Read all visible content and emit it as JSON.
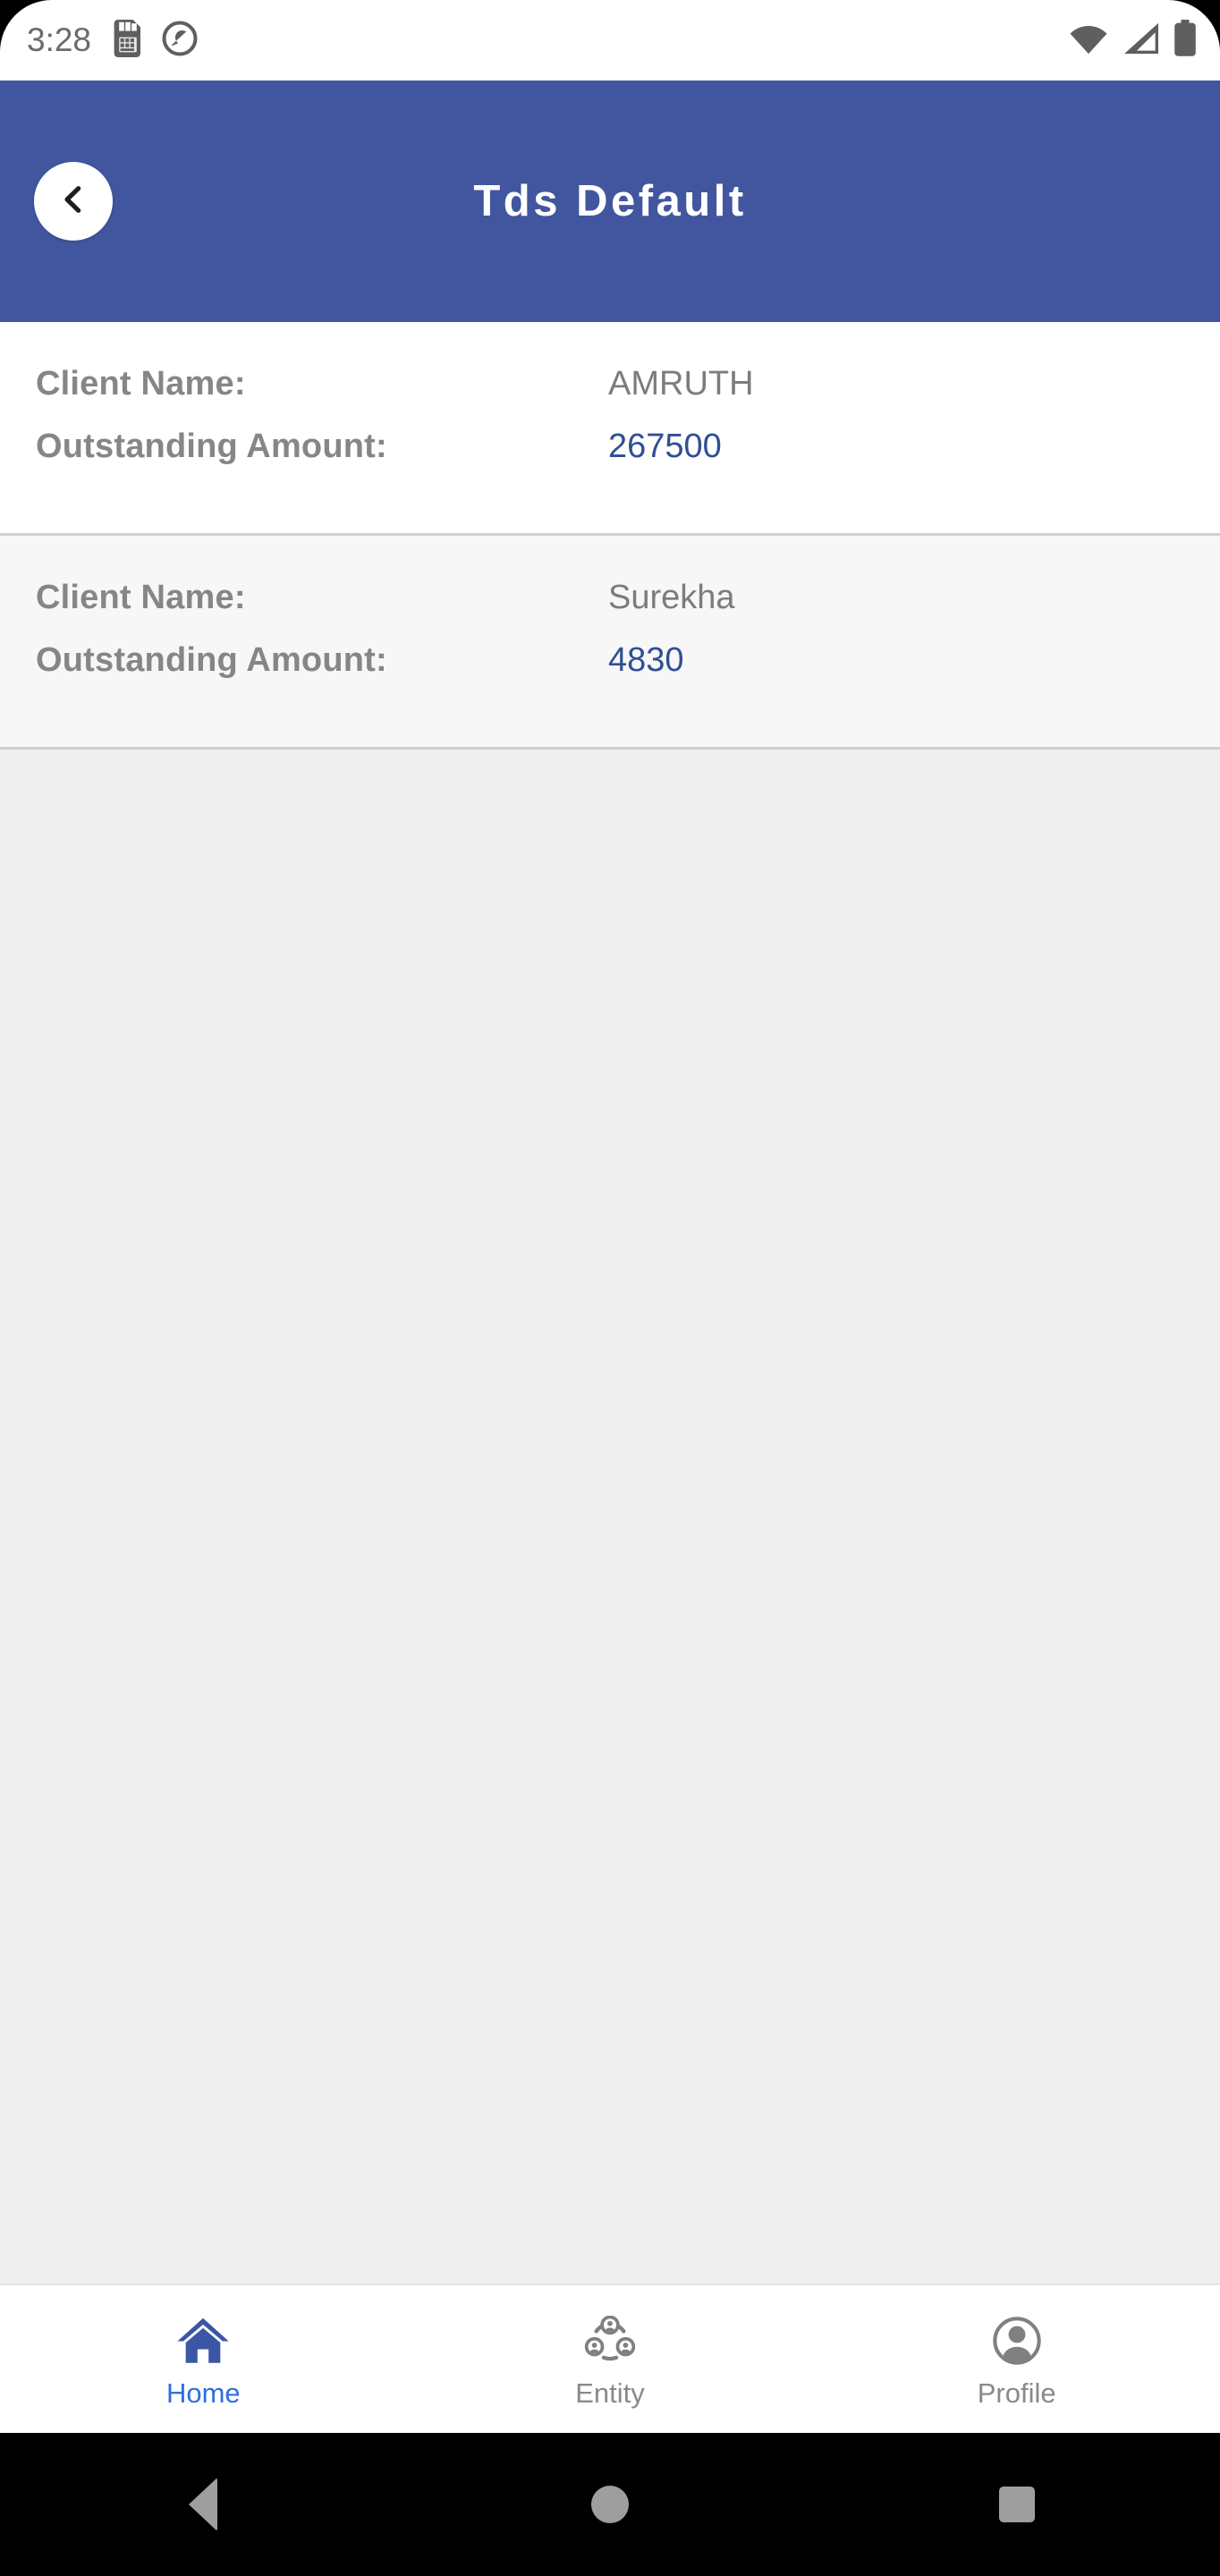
{
  "statusbar": {
    "time": "3:28",
    "left_icons": [
      "sim-card-icon",
      "do-not-disturb-icon"
    ],
    "right_icons": [
      "wifi-icon",
      "cellular-signal-icon",
      "battery-icon"
    ]
  },
  "appbar": {
    "title": "Tds Default",
    "back_icon": "chevron-left-icon",
    "background_color": "#41569E"
  },
  "list": {
    "labels": {
      "client_name": "Client Name:",
      "outstanding_amount": "Outstanding Amount:"
    },
    "items": [
      {
        "client_name": "AMRUTH",
        "outstanding_amount": "267500"
      },
      {
        "client_name": "Surekha",
        "outstanding_amount": "4830"
      }
    ]
  },
  "bottom_nav": {
    "items": [
      {
        "label": "Home",
        "icon": "home-icon",
        "active": true
      },
      {
        "label": "Entity",
        "icon": "group-icon",
        "active": false
      },
      {
        "label": "Profile",
        "icon": "account-icon",
        "active": false
      }
    ]
  },
  "system_nav": {
    "back": "back-triangle-icon",
    "home": "home-circle-icon",
    "recents": "recents-square-icon"
  },
  "colors": {
    "header_blue": "#41569E",
    "amount_blue": "#2F4F94",
    "active_nav_blue": "#2E6FE0",
    "label_gray": "#868686"
  }
}
